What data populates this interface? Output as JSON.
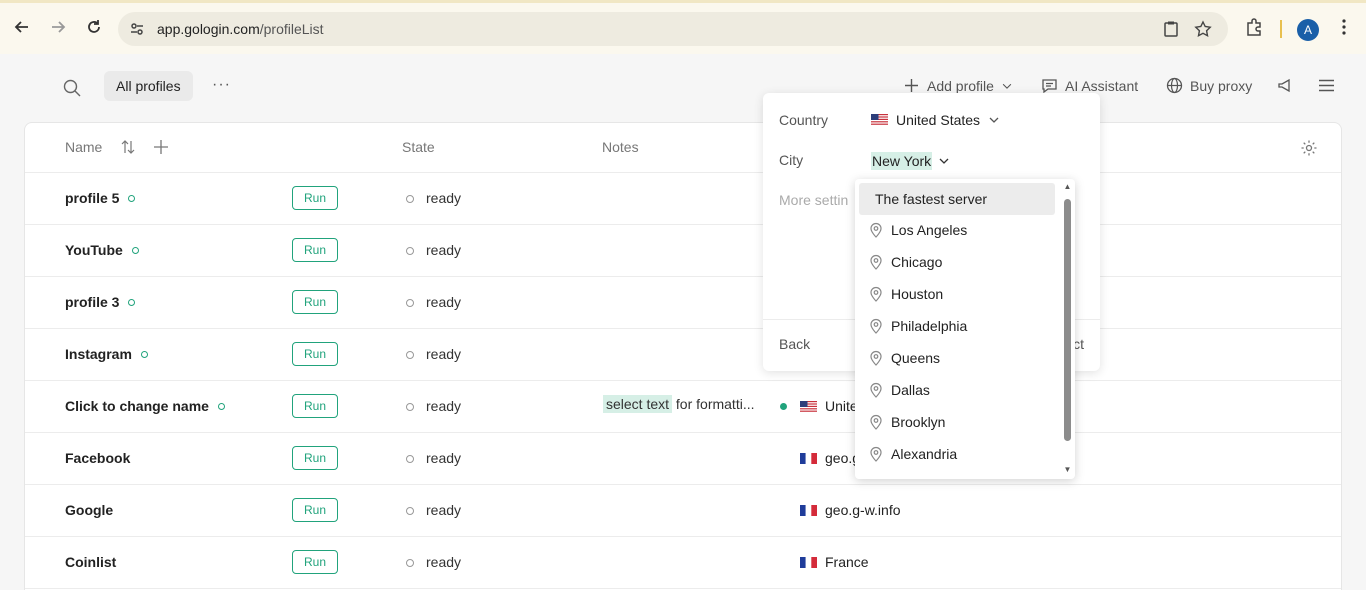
{
  "browser": {
    "url_host": "app.gologin.com",
    "url_path": "/profileList",
    "avatar_letter": "A"
  },
  "toolbar": {
    "tab_all_profiles": "All profiles",
    "more_dots": "···",
    "add_profile": "Add profile",
    "ai_assistant": "AI Assistant",
    "buy_proxy": "Buy proxy"
  },
  "table": {
    "headers": {
      "name": "Name",
      "state": "State",
      "notes": "Notes"
    },
    "run_label": "Run",
    "rows": [
      {
        "name": "profile 5",
        "dot": true,
        "state": "ready",
        "note": "",
        "proxy": "",
        "flag": ""
      },
      {
        "name": "YouTube",
        "dot": true,
        "state": "ready",
        "note": "",
        "proxy": "",
        "flag": ""
      },
      {
        "name": "profile 3",
        "dot": true,
        "state": "ready",
        "note": "",
        "proxy": "",
        "flag": ""
      },
      {
        "name": "Instagram",
        "dot": true,
        "state": "ready",
        "note": "",
        "proxy": "",
        "flag": ""
      },
      {
        "name": "Click to change name",
        "dot": true,
        "state": "ready",
        "note_highlight": "select text",
        "note_rest": " for formatti...",
        "proxy": "Unite",
        "flag": "us"
      },
      {
        "name": "Facebook",
        "dot": false,
        "state": "ready",
        "note": "",
        "proxy": "geo.g",
        "flag": "fr"
      },
      {
        "name": "Google",
        "dot": false,
        "state": "ready",
        "note": "",
        "proxy": "geo.g-w.info",
        "flag": "fr"
      },
      {
        "name": "Coinlist",
        "dot": false,
        "state": "ready",
        "note": "",
        "proxy": "France",
        "flag": "fr"
      }
    ]
  },
  "popover": {
    "country_label": "Country",
    "country_value": "United States",
    "city_label": "City",
    "city_value": "New York",
    "more_settings": "More settin",
    "back": "Back",
    "ct": "ct"
  },
  "city_dropdown": {
    "options": [
      "The fastest server",
      "Los Angeles",
      "Chicago",
      "Houston",
      "Philadelphia",
      "Queens",
      "Dallas",
      "Brooklyn",
      "Alexandria"
    ]
  },
  "colors": {
    "accent": "#21a37c",
    "highlight": "#d6efe6"
  }
}
